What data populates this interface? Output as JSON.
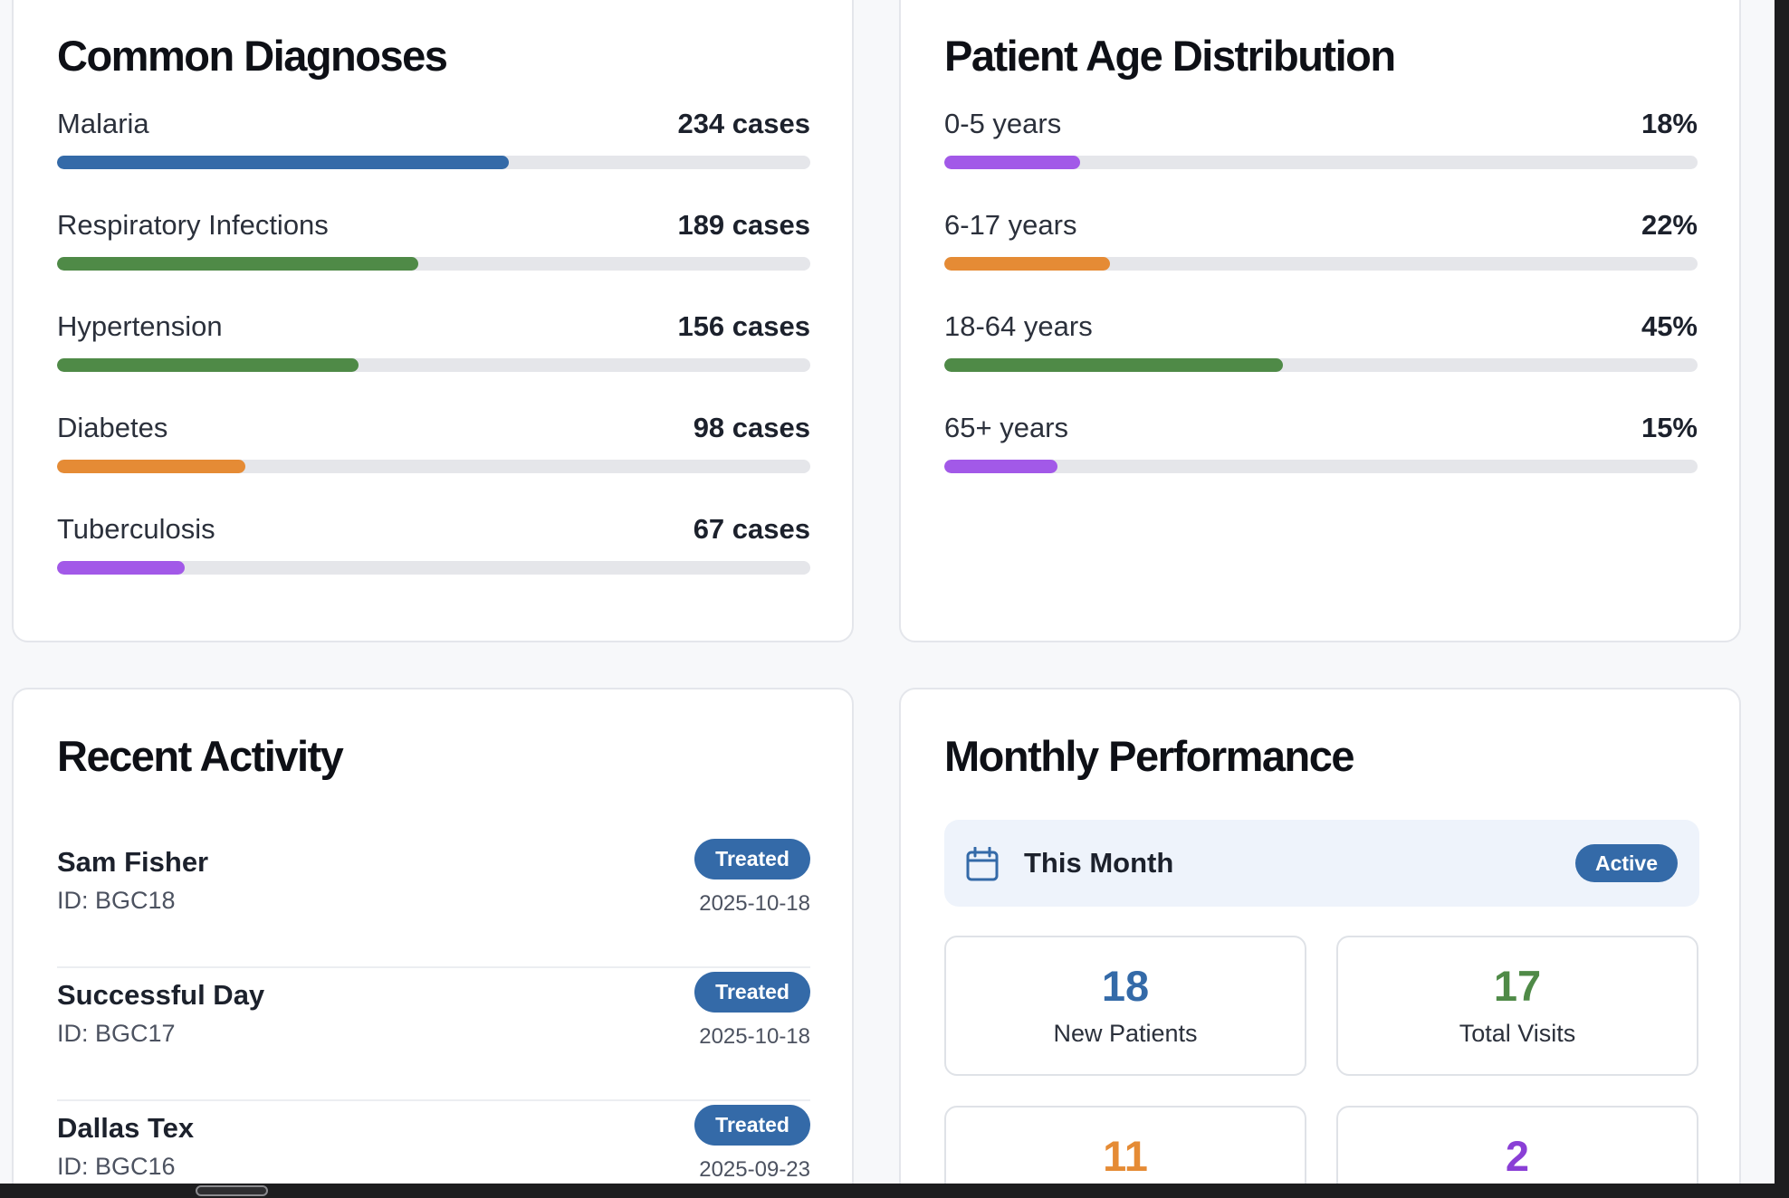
{
  "diagnoses": {
    "title": "Common Diagnoses",
    "items": [
      {
        "label": "Malaria",
        "value": "234 cases",
        "fraction": 0.6,
        "color": "#346aa8"
      },
      {
        "label": "Respiratory Infections",
        "value": "189 cases",
        "fraction": 0.48,
        "color": "#4f8a47"
      },
      {
        "label": "Hypertension",
        "value": "156 cases",
        "fraction": 0.4,
        "color": "#4f8a47"
      },
      {
        "label": "Diabetes",
        "value": "98 cases",
        "fraction": 0.25,
        "color": "#e58b35"
      },
      {
        "label": "Tuberculosis",
        "value": "67 cases",
        "fraction": 0.17,
        "color": "#a259e8"
      }
    ]
  },
  "age_distribution": {
    "title": "Patient Age Distribution",
    "items": [
      {
        "label": "0-5 years",
        "value": "18%",
        "fraction": 0.18,
        "color": "#a259e8"
      },
      {
        "label": "6-17 years",
        "value": "22%",
        "fraction": 0.22,
        "color": "#e58b35"
      },
      {
        "label": "18-64 years",
        "value": "45%",
        "fraction": 0.45,
        "color": "#4f8a47"
      },
      {
        "label": "65+ years",
        "value": "15%",
        "fraction": 0.15,
        "color": "#a259e8"
      }
    ]
  },
  "recent_activity": {
    "title": "Recent Activity",
    "items": [
      {
        "name": "Sam Fisher",
        "id": "ID: BGC18",
        "status": "Treated",
        "date": "2025-10-18"
      },
      {
        "name": "Successful Day",
        "id": "ID: BGC17",
        "status": "Treated",
        "date": "2025-10-18"
      },
      {
        "name": "Dallas Tex",
        "id": "ID: BGC16",
        "status": "Treated",
        "date": "2025-09-23"
      }
    ]
  },
  "monthly_performance": {
    "title": "Monthly Performance",
    "period_icon": "calendar-icon",
    "period_label": "This Month",
    "period_badge": "Active",
    "stats": [
      {
        "value": "18",
        "label": "New Patients",
        "color": "#346aa8"
      },
      {
        "value": "17",
        "label": "Total Visits",
        "color": "#4f8a47"
      },
      {
        "value": "11",
        "label": "",
        "color": "#e58b35"
      },
      {
        "value": "2",
        "label": "",
        "color": "#8a3fd6"
      }
    ]
  }
}
